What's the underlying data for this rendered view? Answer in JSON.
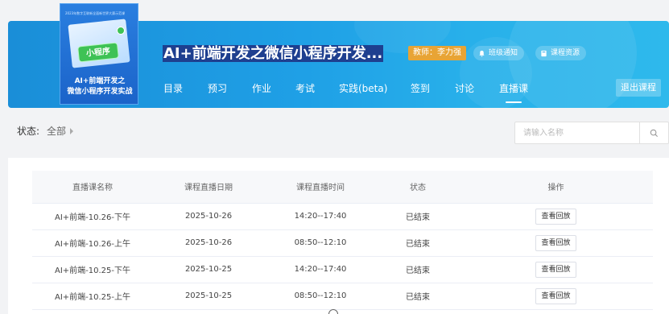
{
  "course": {
    "cover_top_text": "2023年数字互联新全面新世界大赛示范课",
    "cover_badge": "小程序",
    "cover_title_line1": "AI+前端开发之",
    "cover_title_line2": "微信小程序开发实战",
    "title": "AI+前端开发之微信小程序开发...",
    "teacher": "教师：李力强",
    "notice_label": "班级通知",
    "resource_label": "课程资源",
    "exit_label": "退出课程"
  },
  "nav": {
    "items": [
      {
        "label": "目录"
      },
      {
        "label": "预习"
      },
      {
        "label": "作业"
      },
      {
        "label": "考试"
      },
      {
        "label": "实践(beta)"
      },
      {
        "label": "签到"
      },
      {
        "label": "讨论"
      },
      {
        "label": "直播课"
      }
    ],
    "active": "直播课"
  },
  "filter": {
    "label": "状态:",
    "value": "全部"
  },
  "search": {
    "placeholder": "请输入名称"
  },
  "table": {
    "headers": [
      "直播课名称",
      "课程直播日期",
      "课程直播时间",
      "状态",
      "操作"
    ],
    "rows": [
      {
        "name": "AI+前端-10.26-下午",
        "date": "2025-10-26",
        "time": "14:20--17:40",
        "status": "已结束",
        "action": "查看回放"
      },
      {
        "name": "AI+前端-10.26-上午",
        "date": "2025-10-26",
        "time": "08:50--12:10",
        "status": "已结束",
        "action": "查看回放"
      },
      {
        "name": "AI+前端-10.25-下午",
        "date": "2025-10-25",
        "time": "14:20--17:40",
        "status": "已结束",
        "action": "查看回放"
      },
      {
        "name": "AI+前端-10.25-上午",
        "date": "2025-10-25",
        "time": "08:50--12:10",
        "status": "已结束",
        "action": "查看回放"
      }
    ]
  },
  "icons": {
    "notice": "bell-icon",
    "resource": "book-icon",
    "search": "search-icon"
  },
  "colors": {
    "banner": "#1fa0e6",
    "teacher_badge": "#e8a435",
    "title_highlight": "#1e3f8f"
  }
}
